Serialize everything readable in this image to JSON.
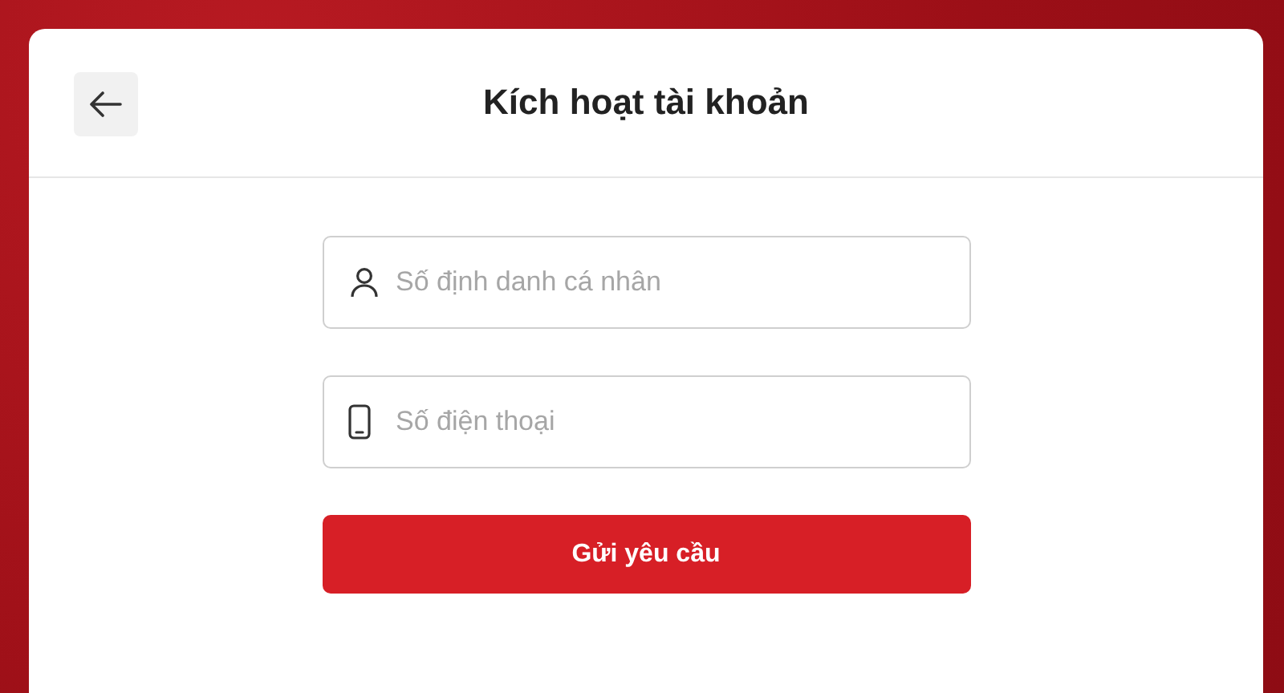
{
  "header": {
    "title": "Kích hoạt tài khoản"
  },
  "fields": [
    {
      "kind": "person",
      "placeholder": "Số định danh cá nhân"
    },
    {
      "kind": "phone",
      "placeholder": "Số điện thoại"
    }
  ],
  "submit_button": "Gửi yêu cầu"
}
